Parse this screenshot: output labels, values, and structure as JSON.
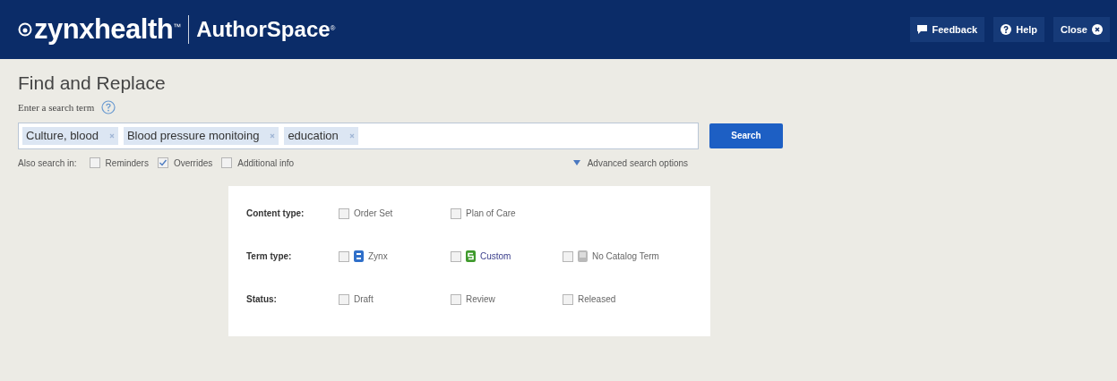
{
  "header": {
    "brand": "zynxhealth",
    "brand_mark": "™",
    "product": "AuthorSpace",
    "product_mark": "®",
    "buttons": [
      {
        "kind": "feedback",
        "label": "Feedback"
      },
      {
        "kind": "help",
        "label": "Help"
      },
      {
        "kind": "close",
        "label": "Close"
      }
    ]
  },
  "title": "Find and Replace",
  "search_label": "Enter a search term",
  "search": {
    "terms": [
      "Culture, blood",
      "Blood pressure monitoing",
      "education"
    ],
    "button": "Search"
  },
  "also_search": {
    "label": "Also search in:",
    "options": [
      {
        "label": "Reminders",
        "checked": false
      },
      {
        "label": "Overrides",
        "checked": true
      },
      {
        "label": "Additional info",
        "checked": false
      }
    ]
  },
  "advanced_link": "Advanced search options",
  "filters": [
    {
      "label": "Content type:",
      "options": [
        {
          "label": "Order Set",
          "checked": false
        },
        {
          "label": "Plan of Care",
          "checked": false
        }
      ]
    },
    {
      "label": "Term type:",
      "options": [
        {
          "label": "Zynx",
          "checked": false,
          "kind": "zynx"
        },
        {
          "label": "Custom",
          "checked": false,
          "kind": "custom"
        },
        {
          "label": "No Catalog Term",
          "checked": false,
          "kind": "none"
        }
      ]
    },
    {
      "label": "Status:",
      "options": [
        {
          "label": "Draft",
          "checked": false
        },
        {
          "label": "Review",
          "checked": false
        },
        {
          "label": "Released",
          "checked": false
        }
      ]
    }
  ]
}
